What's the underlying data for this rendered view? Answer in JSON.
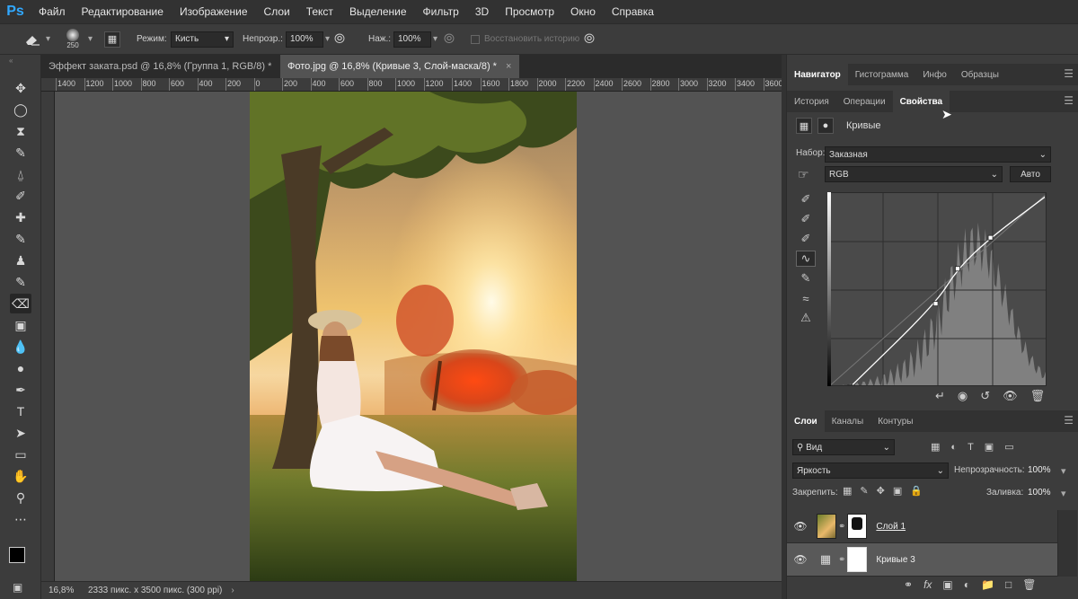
{
  "menubar": {
    "logo": "Ps",
    "items": [
      "Файл",
      "Редактирование",
      "Изображение",
      "Слои",
      "Текст",
      "Выделение",
      "Фильтр",
      "3D",
      "Просмотр",
      "Окно",
      "Справка"
    ]
  },
  "options": {
    "brush_size": "250",
    "mode_label": "Режим:",
    "mode_value": "Кисть",
    "opacity_label": "Непрозр.:",
    "opacity_value": "100%",
    "press_label": "Наж.:",
    "press_value": "100%",
    "restore_label": "Восстановить историю"
  },
  "doc_tabs": [
    {
      "label": "Эффект заката.psd @ 16,8% (Группа 1, RGB/8) *"
    },
    {
      "label": "Фото.jpg @ 16,8% (Кривые 3, Слой-маска/8) *"
    }
  ],
  "ruler_labels": [
    "1400",
    "1200",
    "1000",
    "800",
    "600",
    "400",
    "200",
    "0",
    "200",
    "400",
    "600",
    "800",
    "1000",
    "1200",
    "1400",
    "1600",
    "1800",
    "2000",
    "2200",
    "2400",
    "2600",
    "2800",
    "3000",
    "3200",
    "3400",
    "3600"
  ],
  "status": {
    "zoom": "16,8%",
    "info": "2333 пикс. x 3500 пикс. (300 ppi)"
  },
  "panels": {
    "top_tabs": [
      "Навигатор",
      "Гистограмма",
      "Инфо",
      "Образцы"
    ],
    "second_tabs": [
      "История",
      "Операции",
      "Свойства"
    ],
    "properties_title": "Кривые",
    "preset_label": "Набор:",
    "preset_value": "Заказная",
    "channel_value": "RGB",
    "auto_label": "Авто",
    "layer_tabs": [
      "Слои",
      "Каналы",
      "Контуры"
    ],
    "filter_value": "Вид",
    "blend_value": "Яркость",
    "opacity_label": "Непрозрачность:",
    "opacity_value": "100%",
    "lock_label": "Закрепить:",
    "fill_label": "Заливка:",
    "fill_value": "100%",
    "layers": [
      {
        "name": "Слой 1"
      },
      {
        "name": "Кривые 3"
      }
    ]
  },
  "curve_points": [
    [
      0.1,
      0.0
    ],
    [
      0.49,
      0.43
    ],
    [
      0.59,
      0.61
    ],
    [
      0.74,
      0.77
    ],
    [
      1.0,
      0.99
    ]
  ],
  "colors": {
    "accent": "#31a8ff",
    "panel": "#3c3c3c",
    "canvas": "#535353"
  }
}
